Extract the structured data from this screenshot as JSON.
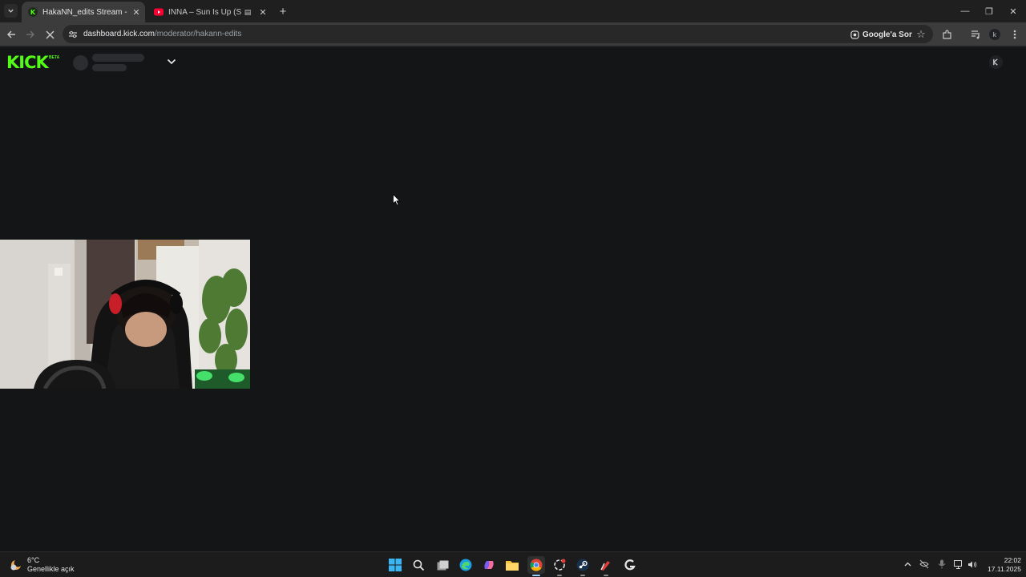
{
  "browser": {
    "tabs": [
      {
        "title": "HakaNN_edits Stream - Kick Da",
        "active": true,
        "favicon": "kick-icon"
      },
      {
        "title": "INNA – Sun Is Up (Slowed)",
        "active": false,
        "favicon": "youtube-icon"
      }
    ],
    "address": {
      "host": "dashboard.kick.com",
      "path": "/moderator/hakann-edits"
    },
    "google_lens_label": "Google'a Sor"
  },
  "page": {
    "logo_text": "KICK",
    "beta_text": "BETA",
    "accent_color": "#53fc18"
  },
  "taskbar": {
    "weather": {
      "temp": "6°C",
      "condition": "Genellikle açık"
    },
    "clock": {
      "time": "22:02",
      "date": "17.11.2025"
    }
  }
}
